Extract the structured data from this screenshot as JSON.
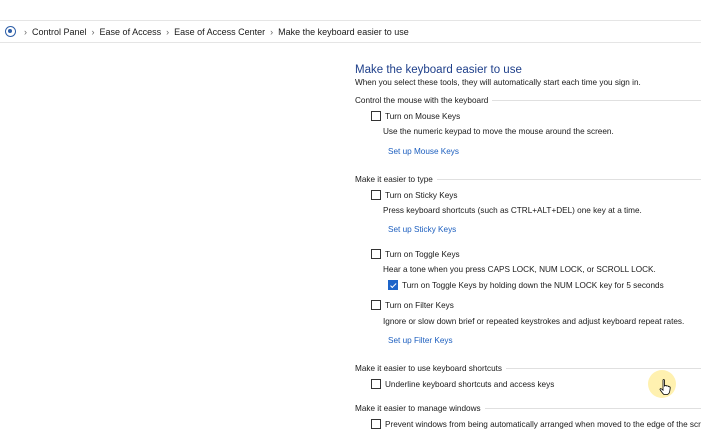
{
  "breadcrumb": {
    "items": [
      "Control Panel",
      "Ease of Access",
      "Ease of Access Center",
      "Make the keyboard easier to use"
    ],
    "separator": "›"
  },
  "main": {
    "title": "Make the keyboard easier to use",
    "subtitle": "When you select these tools, they will automatically start each time you sign in.",
    "sections": {
      "mouse": {
        "heading": "Control the mouse with the keyboard",
        "mouse_keys": {
          "label": "Turn on Mouse Keys",
          "checked": false
        },
        "mouse_keys_desc": "Use the numeric keypad to move the mouse around the screen.",
        "mouse_keys_link": "Set up Mouse Keys"
      },
      "typing": {
        "heading": "Make it easier to type",
        "sticky_keys": {
          "label": "Turn on Sticky Keys",
          "checked": false
        },
        "sticky_keys_desc": "Press keyboard shortcuts (such as CTRL+ALT+DEL) one key at a time.",
        "sticky_keys_link": "Set up Sticky Keys",
        "toggle_keys": {
          "label": "Turn on Toggle Keys",
          "checked": false
        },
        "toggle_keys_desc": "Hear a tone when you press CAPS LOCK, NUM LOCK, or SCROLL LOCK.",
        "toggle_keys_hold": {
          "label": "Turn on Toggle Keys by holding down the NUM LOCK key for 5 seconds",
          "checked": true
        },
        "filter_keys": {
          "label": "Turn on Filter Keys",
          "checked": false
        },
        "filter_keys_desc": "Ignore or slow down brief or repeated keystrokes and adjust keyboard repeat rates.",
        "filter_keys_link": "Set up Filter Keys"
      },
      "shortcuts": {
        "heading": "Make it easier to use keyboard shortcuts",
        "underline": {
          "label": "Underline keyboard shortcuts and access keys",
          "checked": false
        }
      },
      "windows": {
        "heading": "Make it easier to manage windows",
        "prevent_arrange": {
          "label": "Prevent windows from being automatically arranged when moved to the edge of the screen",
          "checked": false
        }
      }
    }
  },
  "colors": {
    "title": "#1e3f8a",
    "link": "#1d5fbf",
    "checkbox_checked": "#1d64c9"
  }
}
